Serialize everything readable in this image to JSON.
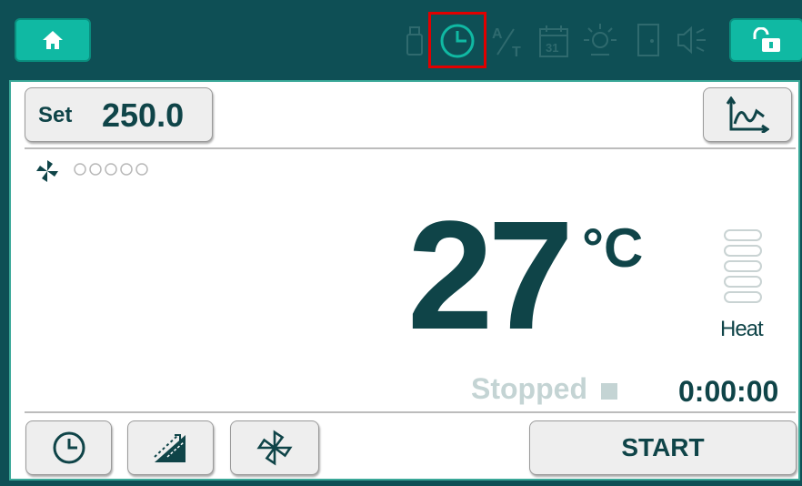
{
  "topbar": {
    "home_icon": "home-icon",
    "status_icons": [
      "usb-icon",
      "clock-icon",
      "auto-timer-icon",
      "calendar-icon",
      "lamp-icon",
      "door-icon",
      "speaker-icon"
    ],
    "calendar_day": "31",
    "auto_timer_text": "A/T",
    "lock_icon": "unlock-icon",
    "highlight_color": "#e00000",
    "accent": "#10b9a3",
    "header_bg": "#0e4f55"
  },
  "setpoint": {
    "label": "Set",
    "value": "250.0"
  },
  "fan": {
    "icon": "fan-icon",
    "speed_level": 0,
    "speed_steps": 5
  },
  "display": {
    "temperature": "27",
    "unit": "°C",
    "heat_label": "Heat",
    "heat_level": 0,
    "heat_steps": 5
  },
  "status": {
    "state": "Stopped",
    "timer": "0:00:00"
  },
  "bottom": {
    "timer_button_icon": "clock-icon",
    "ramp_button_icon": "ramp-icon",
    "fan_button_icon": "fan-icon",
    "start_label": "START"
  },
  "graph_button_icon": "trend-graph-icon"
}
